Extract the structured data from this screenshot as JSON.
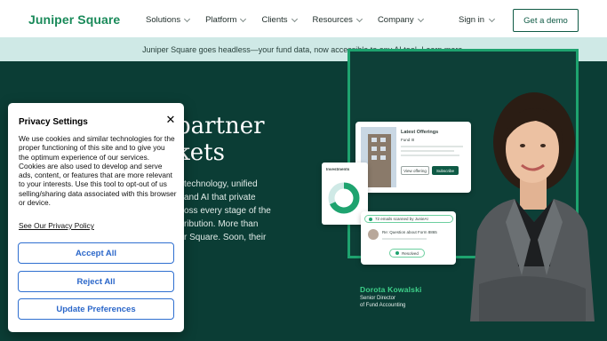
{
  "nav": {
    "logo": "Juniper Square",
    "menu": [
      "Solutions",
      "Platform",
      "Clients",
      "Resources",
      "Company"
    ],
    "signin": "Sign in",
    "demo": "Get a demo"
  },
  "banner": {
    "text": "Juniper Square goes headless—your fund data, now accessible to any AI tool.",
    "link": "Learn more."
  },
  "hero": {
    "headline_line1": "partner",
    "headline_line2": "kets",
    "body_lines": [
      "technology, unified",
      "and AI that private",
      "oss every stage of the",
      "ribution. More than",
      "r Square. Soon, their"
    ]
  },
  "illustration": {
    "offerings_title": "Latest Offerings",
    "fund_label": "Fund III",
    "view_offering": "View offering",
    "subscribe": "Subscribe",
    "investments": "Investments",
    "emails_scanned": "72 emails scanned by JunieAI",
    "question": "Re: Question about Form 8865",
    "resolved": "Resolved",
    "person_name": "Dorota Kowalski",
    "person_role_line1": "Senior Director",
    "person_role_line2": "of Fund Accounting",
    "colors": {
      "frame": "#1ea36f",
      "hero_bg": "#0b3d35",
      "accent": "#3ed18a"
    }
  },
  "privacy": {
    "title": "Privacy Settings",
    "text": "We use cookies and similar technologies for the proper functioning of this site and to give you the optimum experience of our services. Cookies are also used to develop and serve ads, content, or features that are more relevant to your interests. Use this tool to opt-out of us selling/sharing data associated with this browser or device.",
    "policy_link": "See Our Privacy Policy",
    "accept": "Accept All",
    "reject": "Reject All",
    "update": "Update Preferences"
  }
}
